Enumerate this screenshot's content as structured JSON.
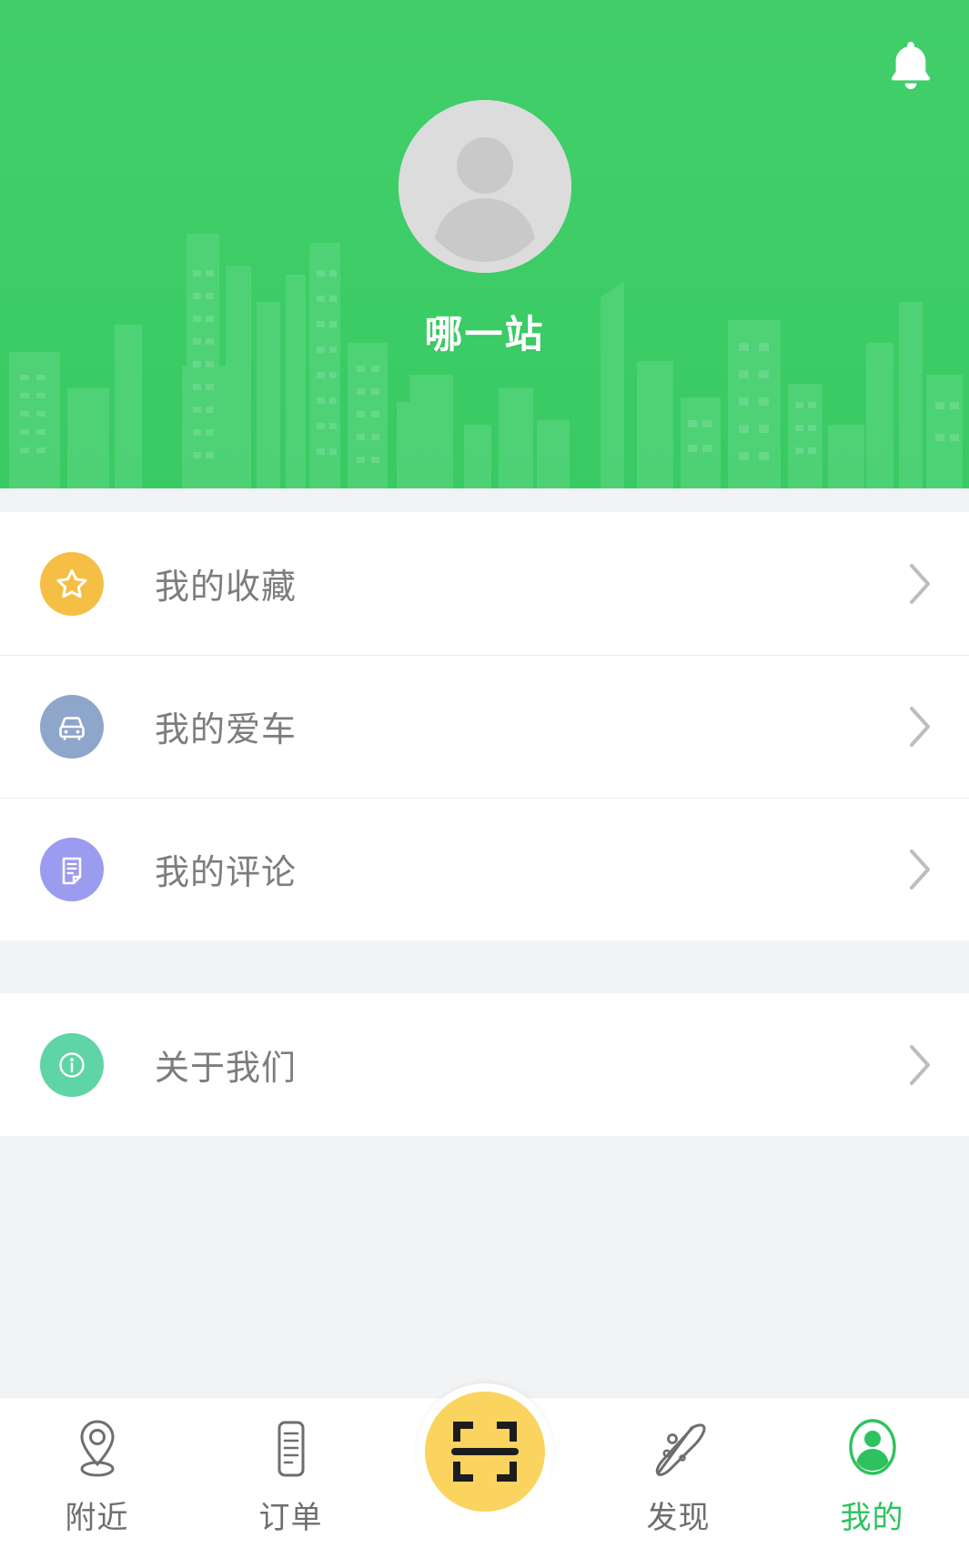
{
  "header": {
    "background_color": "#3ECD67",
    "bell_icon": "bell-icon",
    "avatar_icon": "default-avatar-icon",
    "username": "哪一站",
    "skyline_decoration": "city-skyline-silhouette"
  },
  "menu": {
    "group_one": [
      {
        "id": "favorites",
        "label": "我的收藏",
        "icon": "star-icon",
        "icon_color": "#F5BF45",
        "chevron": "chevron-right-icon"
      },
      {
        "id": "my-car",
        "label": "我的爱车",
        "icon": "car-icon",
        "icon_color": "#8FA6CB",
        "chevron": "chevron-right-icon"
      },
      {
        "id": "my-comments",
        "label": "我的评论",
        "icon": "document-comment-icon",
        "icon_color": "#9B9BF0",
        "chevron": "chevron-right-icon"
      }
    ],
    "group_two": [
      {
        "id": "about-us",
        "label": "关于我们",
        "icon": "info-icon",
        "icon_color": "#5FD4A5",
        "chevron": "chevron-right-icon"
      }
    ]
  },
  "tabbar": {
    "active_color": "#2EC25E",
    "inactive_color": "#6E6E6E",
    "scan_button": {
      "label": "",
      "icon": "qr-scan-icon",
      "color": "#FAD45F"
    },
    "tabs": [
      {
        "id": "nearby",
        "label": "附近",
        "icon": "location-pin-icon",
        "active": false
      },
      {
        "id": "orders",
        "label": "订单",
        "icon": "order-list-icon",
        "active": false
      },
      {
        "id": "scan",
        "label": "",
        "icon": "qr-scan-icon",
        "active": false
      },
      {
        "id": "discover",
        "label": "发现",
        "icon": "planet-discover-icon",
        "active": false
      },
      {
        "id": "mine",
        "label": "我的",
        "icon": "person-icon",
        "active": true
      }
    ]
  }
}
